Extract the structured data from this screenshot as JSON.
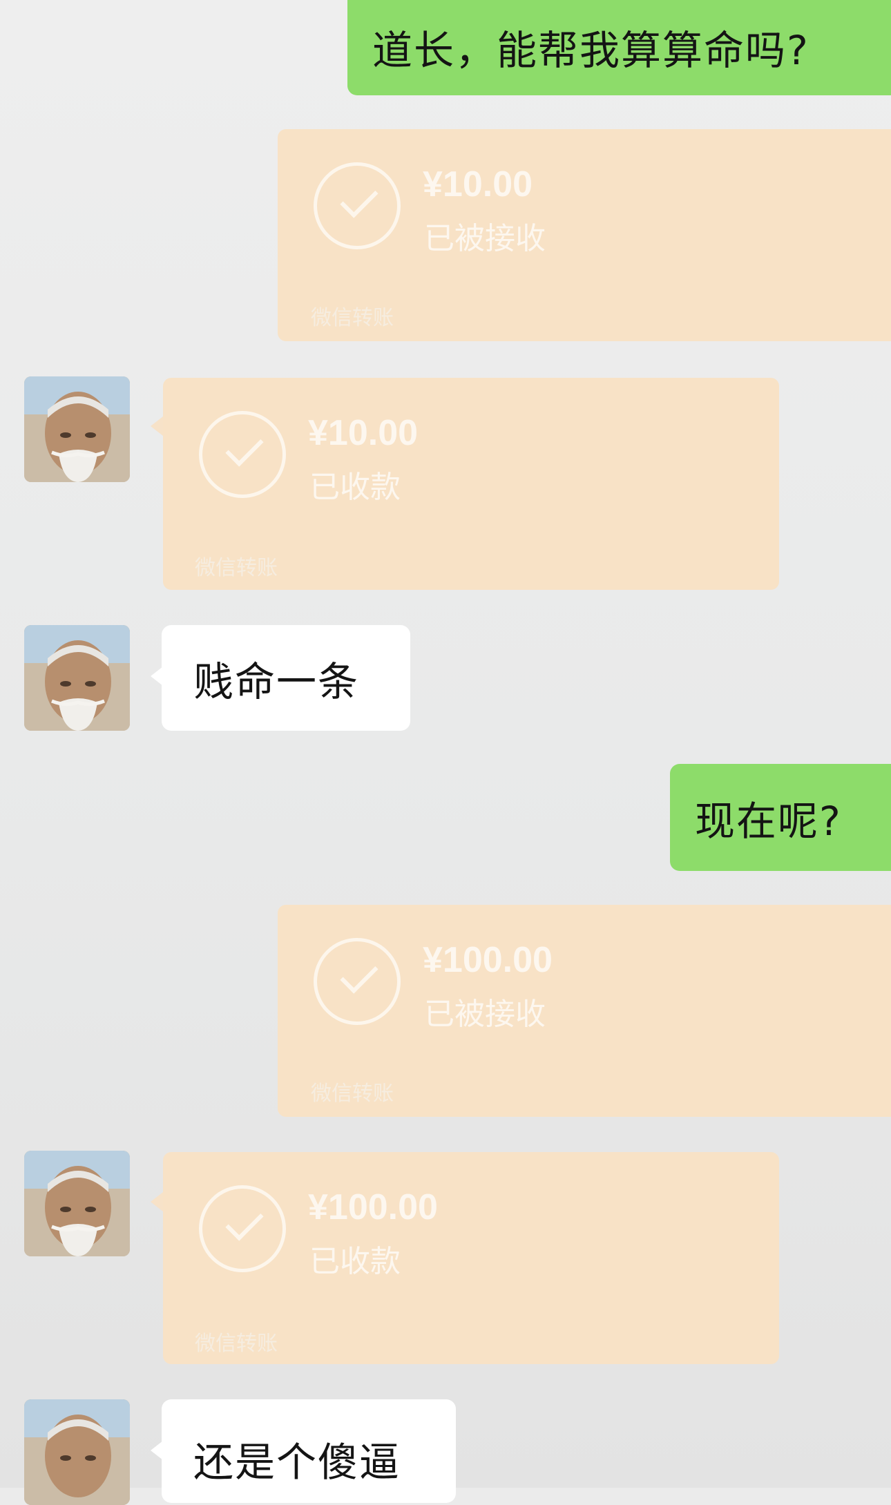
{
  "messages": {
    "m1": {
      "text": "道长，能帮我算算命吗?"
    },
    "t1": {
      "amount": "¥10.00",
      "status": "已被接收",
      "footer": "微信转账"
    },
    "t2": {
      "amount": "¥10.00",
      "status": "已收款",
      "footer": "微信转账"
    },
    "m2": {
      "text": "贱命一条"
    },
    "m3": {
      "text": "现在呢?"
    },
    "t3": {
      "amount": "¥100.00",
      "status": "已被接收",
      "footer": "微信转账"
    },
    "t4": {
      "amount": "¥100.00",
      "status": "已收款",
      "footer": "微信转账"
    },
    "m4": {
      "text": "还是个傻逼"
    }
  },
  "colors": {
    "sent_bubble": "#8ddc6a",
    "received_bubble": "#ffffff",
    "transfer_card": "#f8e2c6",
    "background": "#ebebeb"
  },
  "icons": {
    "transfer_status": "check-circle-icon",
    "avatar": "elder-avatar"
  }
}
